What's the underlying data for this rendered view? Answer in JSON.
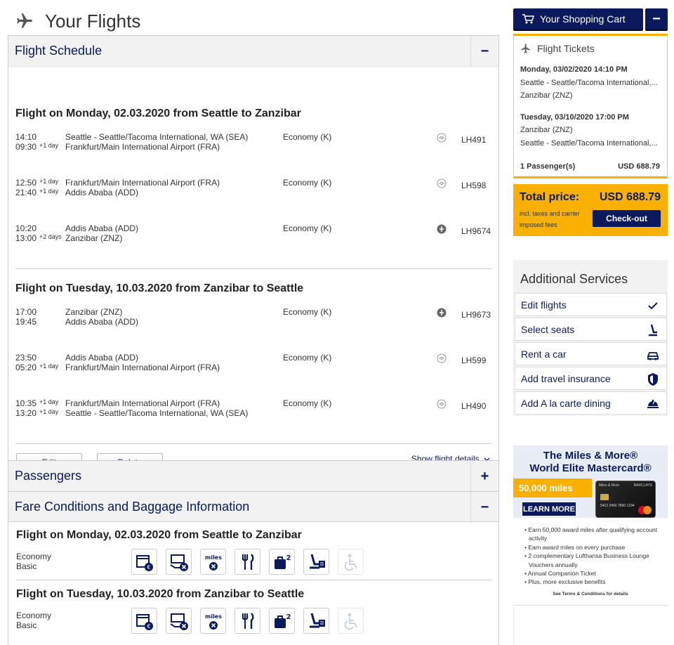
{
  "page": {
    "title": "Your Flights"
  },
  "schedule": {
    "title": "Flight Schedule",
    "toggle": "−",
    "outbound": {
      "heading": "Flight on Monday, 02.03.2020 from Seattle to Zanzibar",
      "segments": [
        {
          "dep": "14:10",
          "arr": "09:30",
          "dep_day": "",
          "arr_day": "+1 day",
          "from": "Seattle - Seattle/Tacoma International, WA (SEA)",
          "to": "Frankfurt/Main International Airport (FRA)",
          "cls": "Economy (K)",
          "flight": "LH491",
          "logo": "lufthansa"
        },
        {
          "dep": "12:50",
          "arr": "21:40",
          "dep_day": "+1 day",
          "arr_day": "+1 day",
          "from": "Frankfurt/Main International Airport (FRA)",
          "to": "Addis Ababa (ADD)",
          "cls": "Economy (K)",
          "flight": "LH598",
          "logo": "lufthansa"
        },
        {
          "dep": "10:20",
          "arr": "13:00",
          "dep_day": "",
          "arr_day": "+2 days",
          "from": "Addis Ababa (ADD)",
          "to": "Zanzibar (ZNZ)",
          "cls": "Economy (K)",
          "flight": "LH9674",
          "logo": "partner"
        }
      ]
    },
    "inbound": {
      "heading": "Flight on Tuesday, 10.03.2020 from Zanzibar to Seattle",
      "segments": [
        {
          "dep": "17:00",
          "arr": "19:45",
          "dep_day": "",
          "arr_day": "",
          "from": "Zanzibar (ZNZ)",
          "to": "Addis Ababa (ADD)",
          "cls": "Economy (K)",
          "flight": "LH9673",
          "logo": "partner"
        },
        {
          "dep": "23:50",
          "arr": "05:20",
          "dep_day": "",
          "arr_day": "+1 day",
          "from": "Addis Ababa (ADD)",
          "to": "Frankfurt/Main International Airport (FRA)",
          "cls": "Economy (K)",
          "flight": "LH599",
          "logo": "lufthansa"
        },
        {
          "dep": "10:35",
          "arr": "13:20",
          "dep_day": "+1 day",
          "arr_day": "+1 day",
          "from": "Frankfurt/Main International Airport (FRA)",
          "to": "Seattle - Seattle/Tacoma International, WA (SEA)",
          "cls": "Economy (K)",
          "flight": "LH490",
          "logo": "lufthansa"
        }
      ]
    },
    "edit_label": "Edit",
    "delete_label": "Delete",
    "show_details": "Show flight details"
  },
  "passengers": {
    "title": "Passengers",
    "toggle": "+"
  },
  "fare": {
    "title": "Fare Conditions and Baggage Information",
    "toggle": "−",
    "flights": [
      {
        "heading": "Flight on Monday, 02.03.2020 from Seattle to Zanzibar",
        "cls1": "Economy",
        "cls2": "Basic"
      },
      {
        "heading": "Flight on Tuesday, 10.03.2020 from Zanzibar to Seattle",
        "cls1": "Economy",
        "cls2": "Basic"
      }
    ],
    "icons": [
      "rebooking-fee-icon",
      "refund-fee-icon",
      "miles-icon",
      "meal-icon",
      "baggage-icon",
      "seat-reservation-icon",
      "assistance-icon"
    ],
    "miles_text": "miles",
    "baggage_count": "2"
  },
  "cart": {
    "button": "Your Shopping Cart",
    "minimize": "−",
    "tickets_title": "Flight Tickets",
    "out_date": "Monday, 03/02/2020 14:10 PM",
    "out_from": "Seattle - Seattle/Tacoma International,...",
    "out_to": "Zanzibar (ZNZ)",
    "in_date": "Tuesday, 03/10/2020 17:00 PM",
    "in_from": "Zanzibar (ZNZ)",
    "in_to": "Seattle - Seattle/Tacoma International,...",
    "passengers": "1 Passenger(s)",
    "passengers_price": "USD 688.79",
    "total_label": "Total price:",
    "total_amount": "USD 688.79",
    "total_note": "incl. taxes and carrier imposed fees",
    "checkout": "Check-out"
  },
  "services": {
    "title": "Additional Services",
    "items": [
      {
        "label": "Edit flights",
        "icon": "check-icon"
      },
      {
        "label": "Select seats",
        "icon": "seat-icon"
      },
      {
        "label": "Rent a car",
        "icon": "car-icon"
      },
      {
        "label": "Add travel insurance",
        "icon": "shield-icon"
      },
      {
        "label": "Add A la carte dining",
        "icon": "dining-icon"
      }
    ]
  },
  "ad": {
    "title1": "The Miles & More®",
    "title2": "World Elite Mastercard®",
    "miles": "50,000 miles",
    "learn": "LEARN MORE",
    "card_brand": "Miles & More",
    "card_bank": "BARCLAYS",
    "card_number": "5412 3456 7890 1234",
    "bullets": [
      "Earn 50,000 award miles after qualifying account activity",
      "Earn award miles on every purchase",
      "2 complementary Lufthansa Business Lounge Vouchers annually",
      "Annual Companion Ticket",
      "Plus, more exclusive benefits"
    ],
    "terms": "See Terms & Conditions for details"
  },
  "colors": {
    "navy": "#0a1a5c",
    "yellow": "#f9b000",
    "panel_grey": "#f2f2f2"
  }
}
